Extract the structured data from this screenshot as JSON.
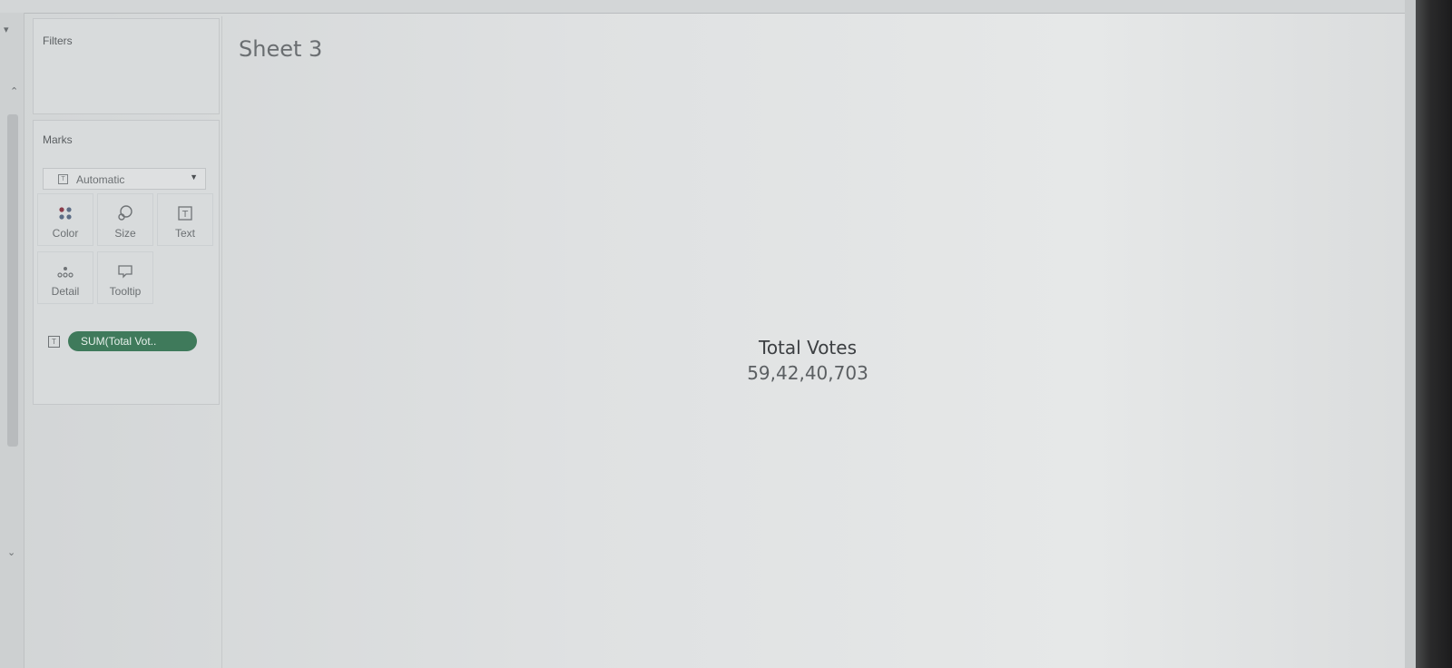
{
  "side_panel": {
    "filters_title": "Filters",
    "marks_title": "Marks",
    "mark_type": "Automatic",
    "mark_buttons": [
      {
        "label": "Color",
        "icon": "color-dots-icon"
      },
      {
        "label": "Size",
        "icon": "size-icon"
      },
      {
        "label": "Text",
        "icon": "text-icon"
      },
      {
        "label": "Detail",
        "icon": "detail-icon"
      },
      {
        "label": "Tooltip",
        "icon": "tooltip-icon"
      }
    ],
    "field_pill": "SUM(Total Vot.."
  },
  "view": {
    "sheet_title": "Sheet 3",
    "kpi_label": "Total Votes",
    "kpi_value": "59,42,40,703"
  },
  "colors": {
    "pill_green": "#3f7a5b",
    "background": "#dfe1e2"
  }
}
